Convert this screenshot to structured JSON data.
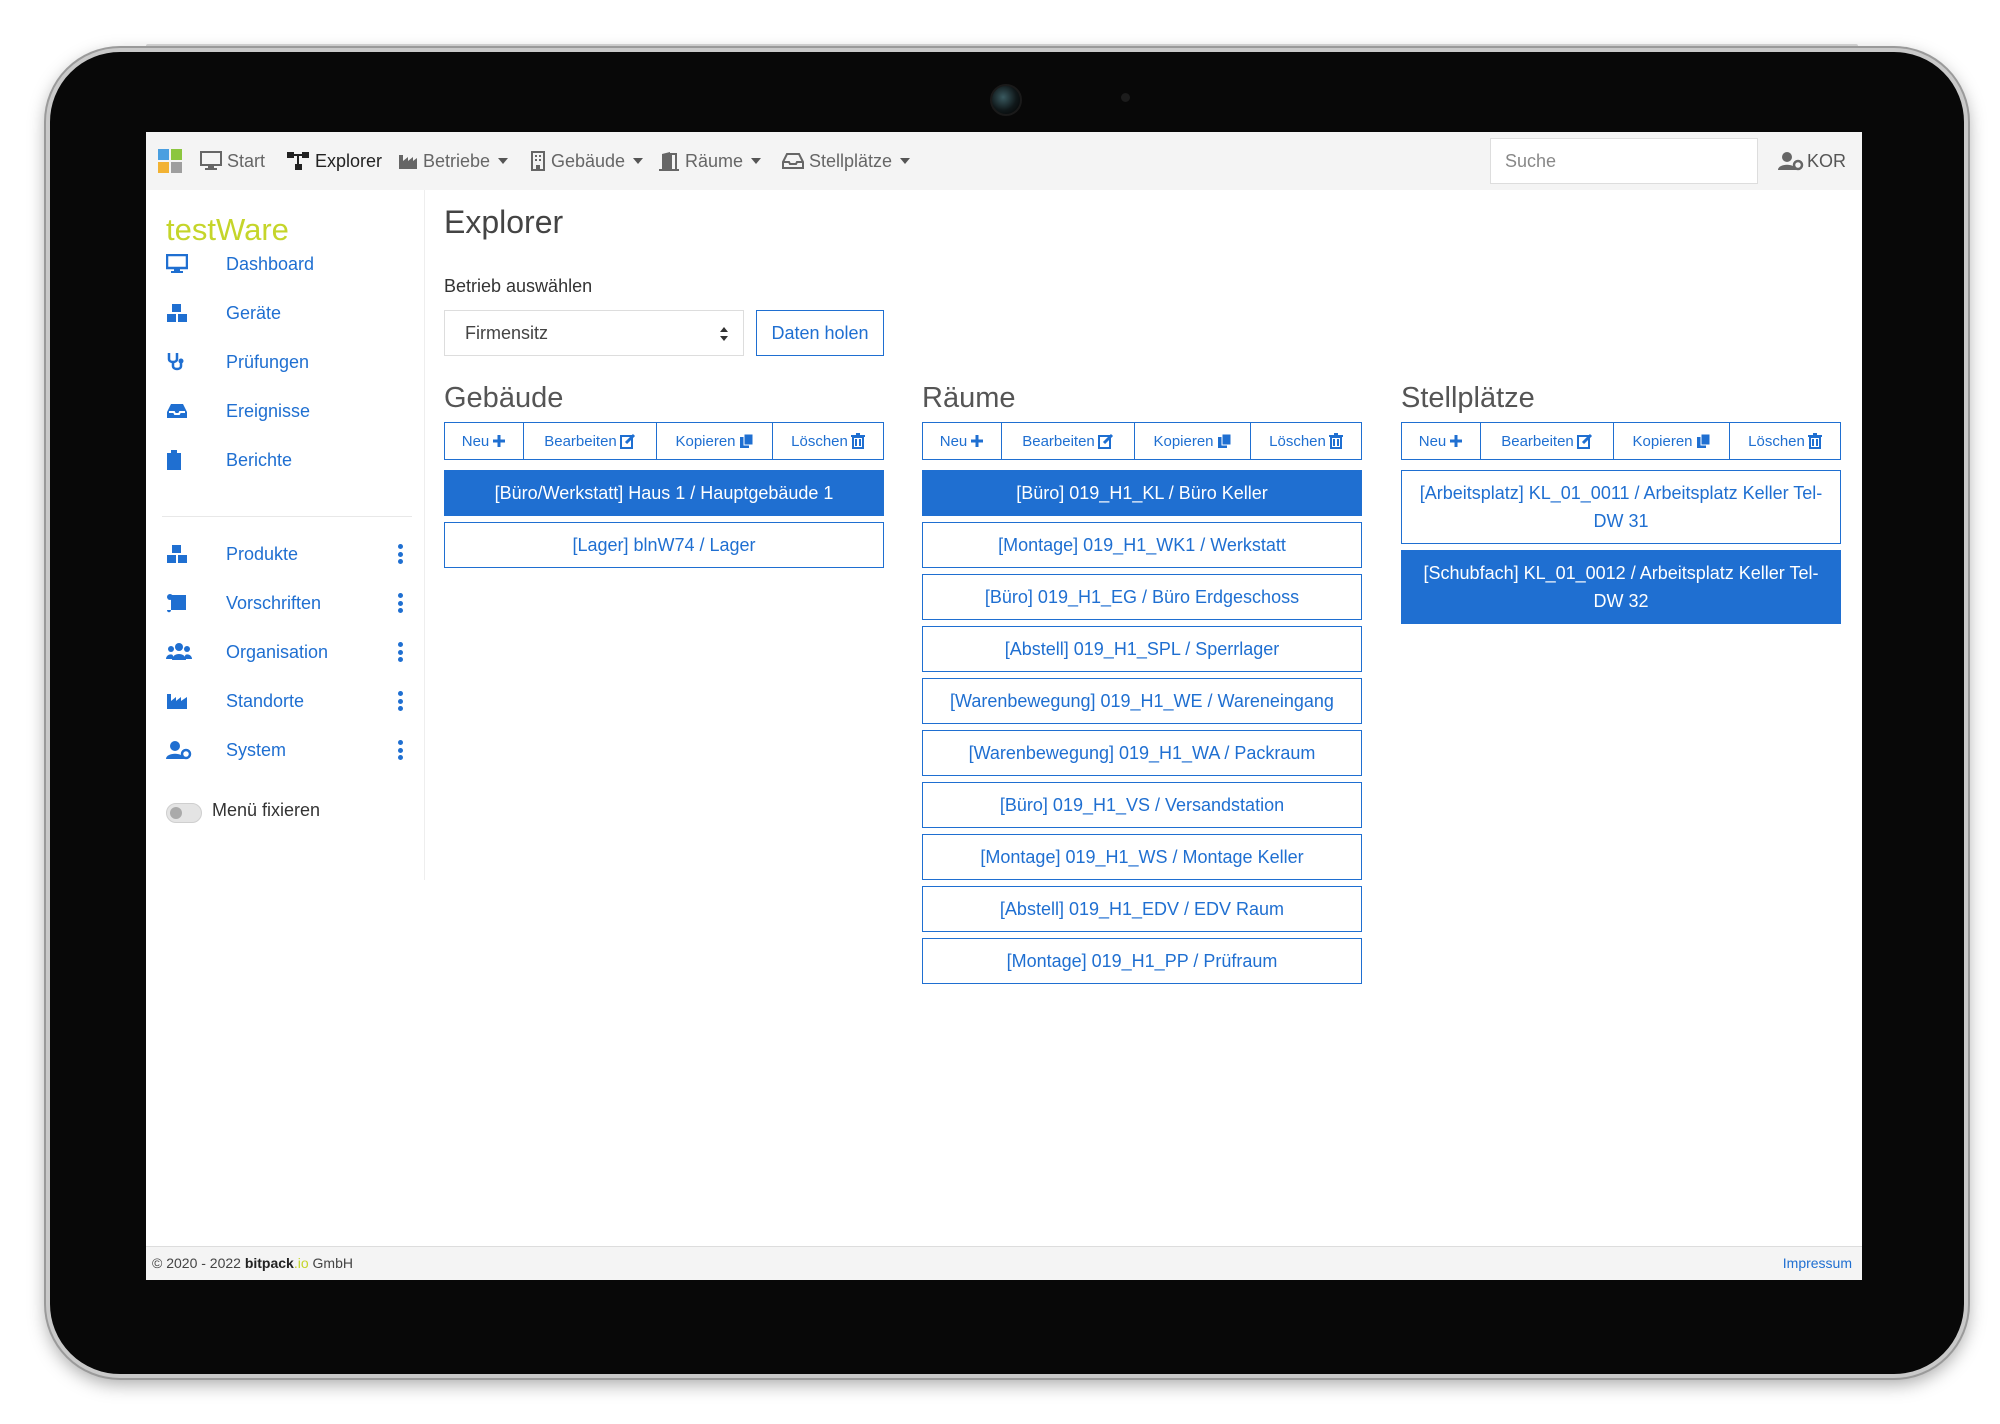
{
  "nav": {
    "items": [
      {
        "label": "Start",
        "icon": "desktop-icon"
      },
      {
        "label": "Explorer",
        "icon": "sitemap-icon"
      },
      {
        "label": "Betriebe",
        "icon": "industry-icon"
      },
      {
        "label": "Gebäude",
        "icon": "building-icon"
      },
      {
        "label": "Räume",
        "icon": "door-icon"
      },
      {
        "label": "Stellplätze",
        "icon": "inbox-icon"
      }
    ],
    "search_placeholder": "Suche",
    "user": "KOR"
  },
  "sidebar": {
    "brand": "testWare",
    "items": [
      {
        "label": "Dashboard",
        "icon": "desktop-icon"
      },
      {
        "label": "Geräte",
        "icon": "boxes-icon"
      },
      {
        "label": "Prüfungen",
        "icon": "stethoscope-icon"
      },
      {
        "label": "Ereignisse",
        "icon": "inbox-icon"
      },
      {
        "label": "Berichte",
        "icon": "clipboard-icon"
      }
    ],
    "groups": [
      {
        "label": "Produkte",
        "icon": "boxes-icon"
      },
      {
        "label": "Vorschriften",
        "icon": "scroll-icon"
      },
      {
        "label": "Organisation",
        "icon": "users-icon"
      },
      {
        "label": "Standorte",
        "icon": "industry-icon"
      },
      {
        "label": "System",
        "icon": "user-cog-icon"
      }
    ],
    "toggle_label": "Menü fixieren"
  },
  "main": {
    "title": "Explorer",
    "select_label": "Betrieb auswählen",
    "select_value": "Firmensitz",
    "fetch_button": "Daten holen",
    "actions": {
      "new": "Neu",
      "edit": "Bearbeiten",
      "copy": "Kopieren",
      "delete": "Löschen"
    },
    "columns": [
      {
        "title": "Gebäude",
        "items": [
          {
            "label": "[Büro/Werkstatt] Haus 1 / Hauptgebäude 1",
            "selected": true
          },
          {
            "label": "[Lager] blnW74 / Lager",
            "selected": false
          }
        ]
      },
      {
        "title": "Räume",
        "items": [
          {
            "label": "[Büro] 019_H1_KL / Büro Keller",
            "selected": true
          },
          {
            "label": "[Montage] 019_H1_WK1 / Werkstatt",
            "selected": false
          },
          {
            "label": "[Büro] 019_H1_EG / Büro Erdgeschoss",
            "selected": false
          },
          {
            "label": "[Abstell] 019_H1_SPL / Sperrlager",
            "selected": false
          },
          {
            "label": "[Warenbewegung] 019_H1_WE / Wareneingang",
            "selected": false
          },
          {
            "label": "[Warenbewegung] 019_H1_WA / Packraum",
            "selected": false
          },
          {
            "label": "[Büro] 019_H1_VS / Versandstation",
            "selected": false
          },
          {
            "label": "[Montage] 019_H1_WS / Montage Keller",
            "selected": false
          },
          {
            "label": "[Abstell] 019_H1_EDV / EDV Raum",
            "selected": false
          },
          {
            "label": "[Montage] 019_H1_PP / Prüfraum",
            "selected": false
          }
        ]
      },
      {
        "title": "Stellplätze",
        "items": [
          {
            "label": "[Arbeitsplatz] KL_01_0011 / Arbeitsplatz Keller Tel-DW 31",
            "selected": false
          },
          {
            "label": "[Schubfach] KL_01_0012 / Arbeitsplatz Keller Tel-DW 32",
            "selected": true
          }
        ]
      }
    ]
  },
  "footer": {
    "copyright_prefix": "© 2020 - 2022",
    "company_bold": "bitpack",
    "company_io": ".io",
    "company_suffix": "GmbH",
    "impressum": "Impressum"
  },
  "colors": {
    "accent": "#1f6fd1",
    "brand": "#c5d52a",
    "logo_tiles": [
      "#4a9fe0",
      "#8cc63f",
      "#f2b233",
      "#9e9e9e"
    ]
  }
}
